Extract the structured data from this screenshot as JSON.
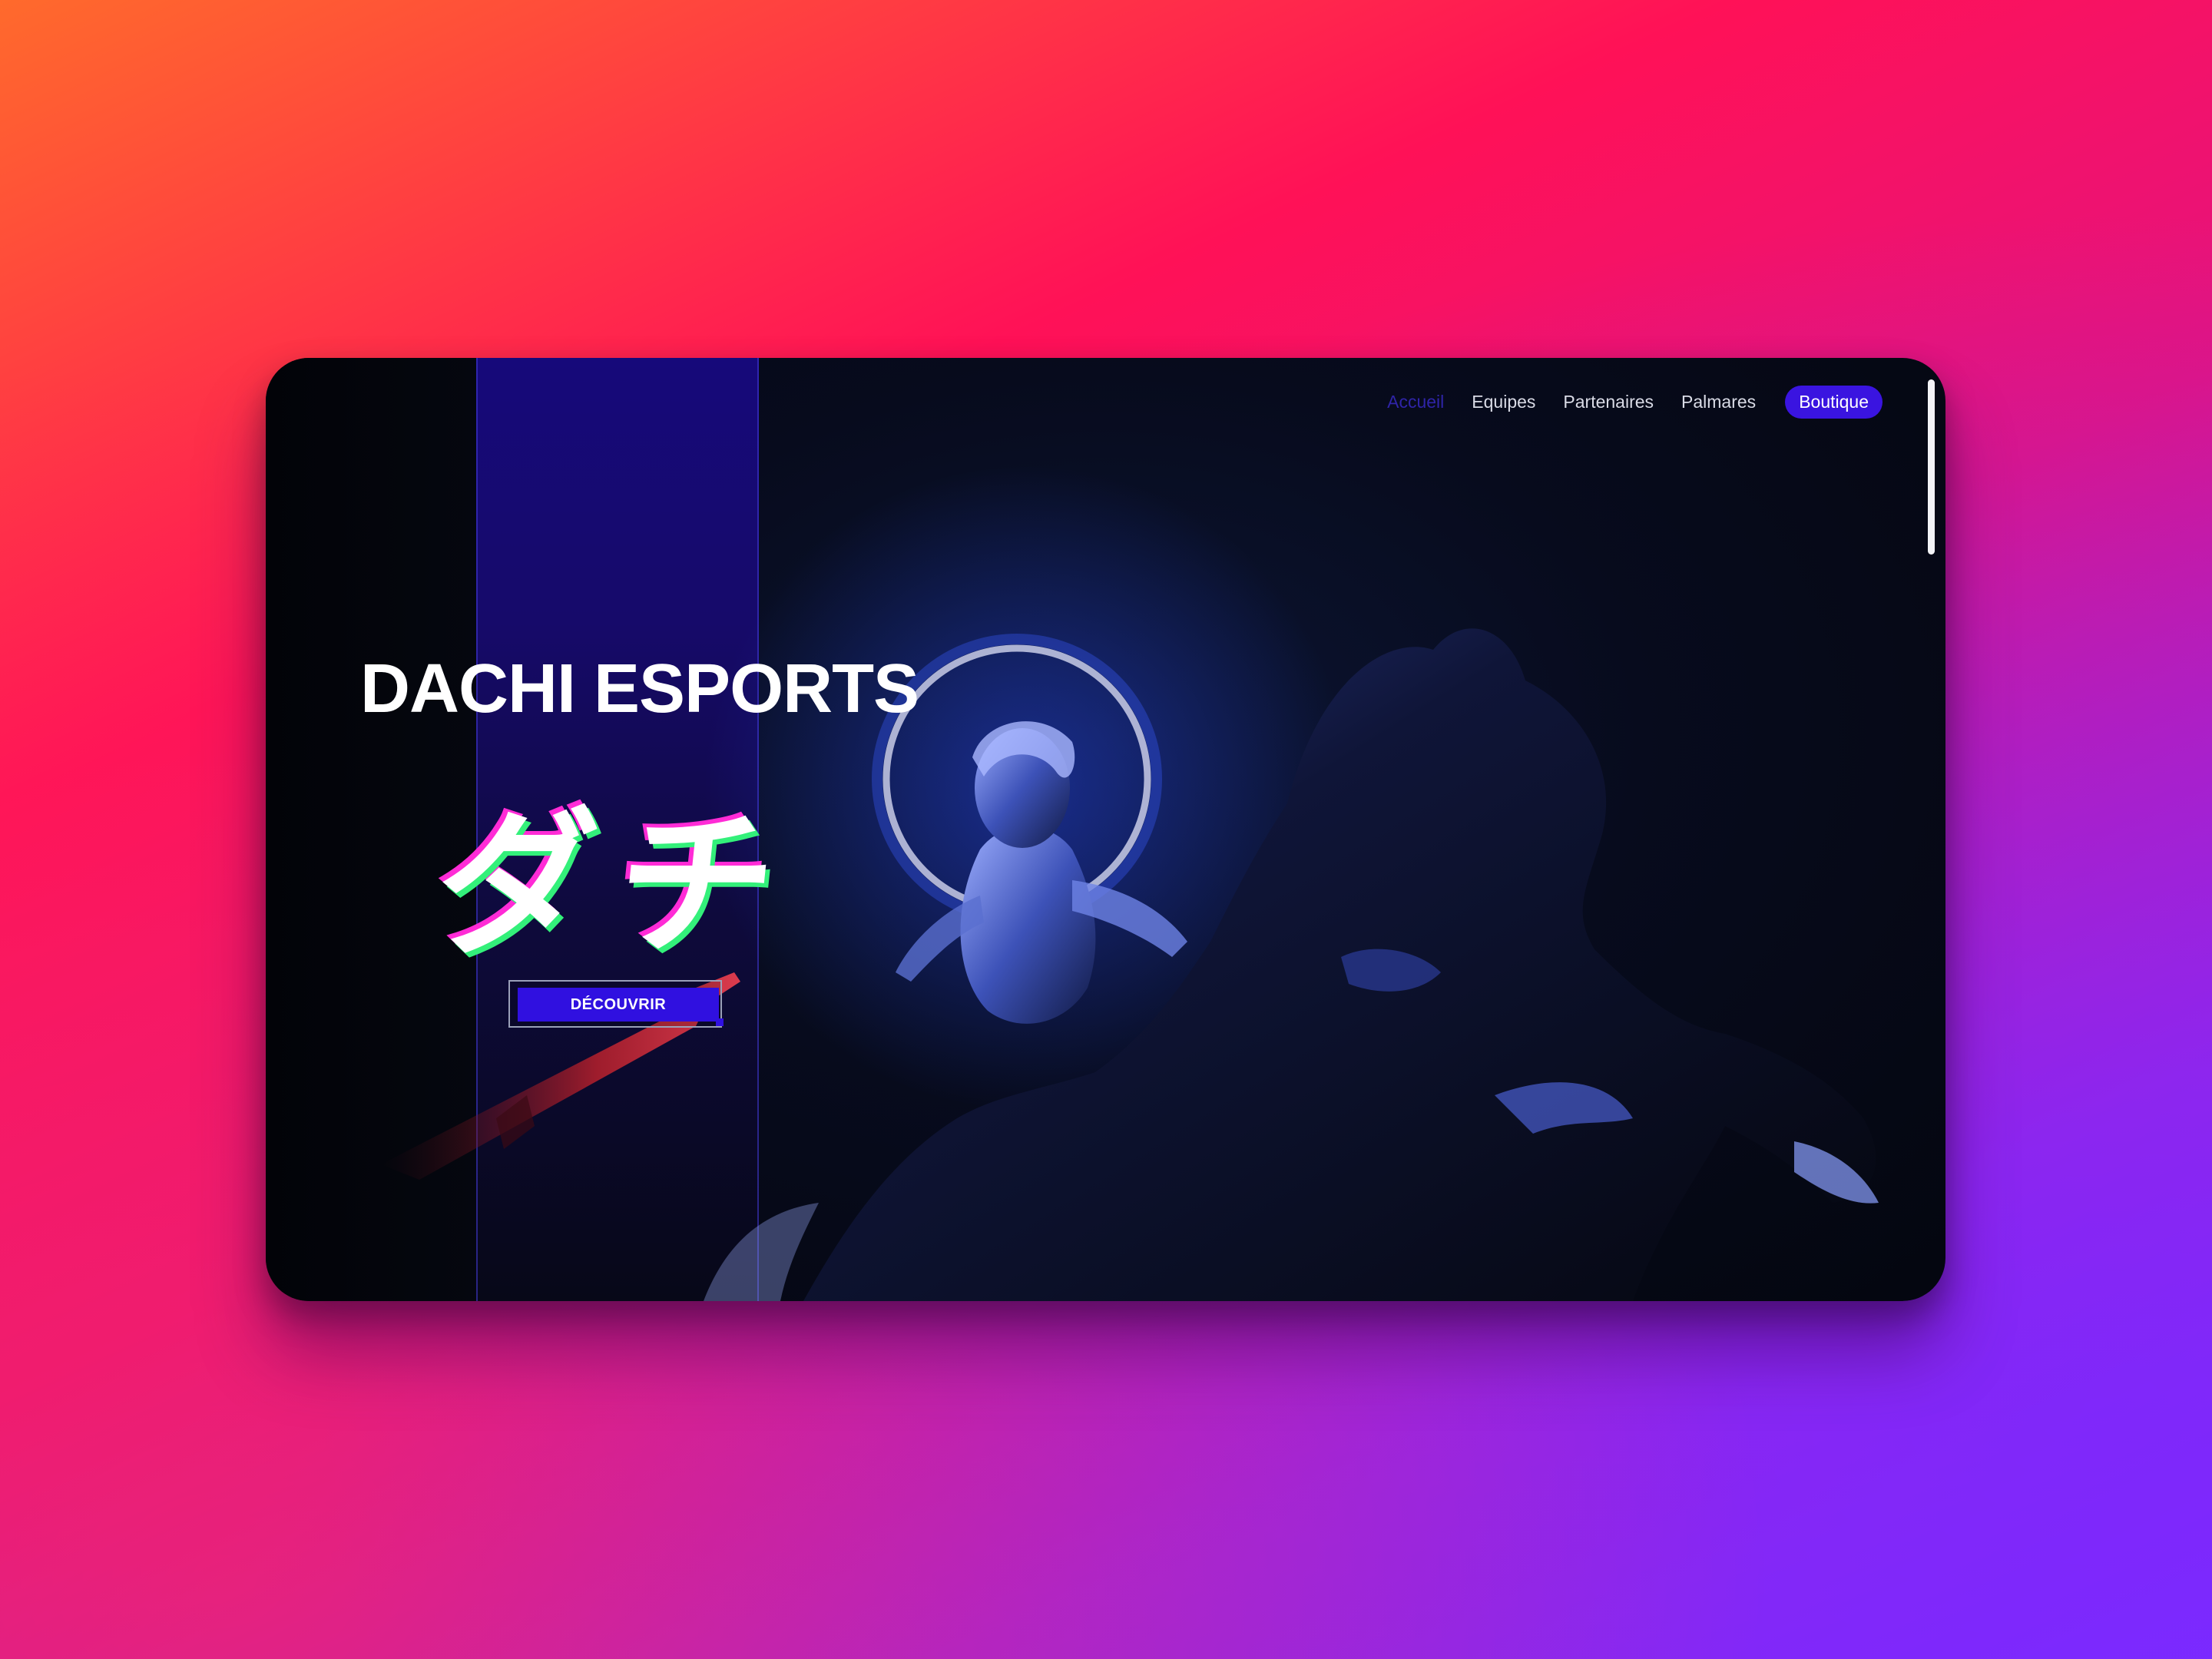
{
  "nav": {
    "items": [
      {
        "label": "Accueil",
        "active": true
      },
      {
        "label": "Equipes",
        "active": false
      },
      {
        "label": "Partenaires",
        "active": false
      },
      {
        "label": "Palmares",
        "active": false
      }
    ],
    "shop_label": "Boutique"
  },
  "hero": {
    "title": "DACHI ESPORTS",
    "kana": "ダチ",
    "cta_label": "DÉCOUVRIR"
  },
  "colors": {
    "accent": "#3a14e0",
    "band": "#160a6a",
    "glitch_green": "#33f07a",
    "glitch_pink": "#ff2bd6"
  },
  "icons": [
    "statue-illustration",
    "halo-ring"
  ]
}
